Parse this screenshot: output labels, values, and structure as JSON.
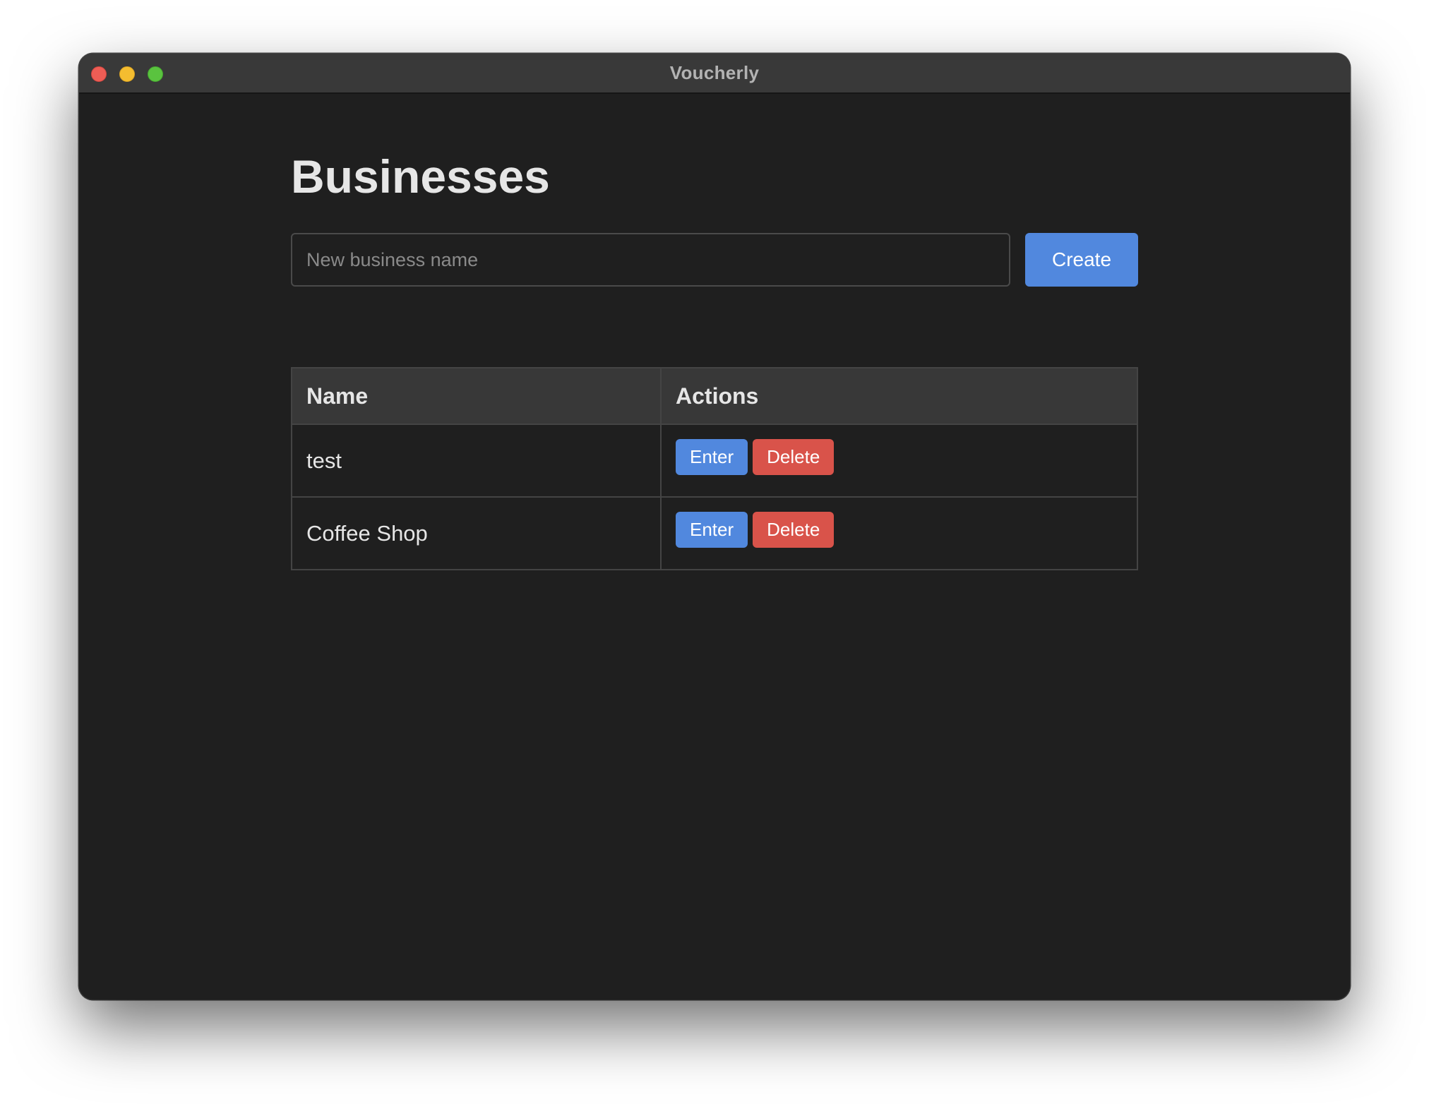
{
  "window": {
    "title": "Voucherly"
  },
  "page": {
    "title": "Businesses"
  },
  "create_form": {
    "input_value": "",
    "input_placeholder": "New business name",
    "create_label": "Create"
  },
  "table": {
    "columns": [
      "Name",
      "Actions"
    ],
    "rows": [
      {
        "name": "test",
        "enter_label": "Enter",
        "delete_label": "Delete"
      },
      {
        "name": "Coffee Shop",
        "enter_label": "Enter",
        "delete_label": "Delete"
      }
    ]
  },
  "colors": {
    "window_bg": "#1f1f1f",
    "titlebar_bg": "#393939",
    "primary_button": "#5188de",
    "danger_button": "#d9534a",
    "traffic_close": "#ee5d55",
    "traffic_minimize": "#f4bd30",
    "traffic_zoom": "#5ac33f"
  }
}
